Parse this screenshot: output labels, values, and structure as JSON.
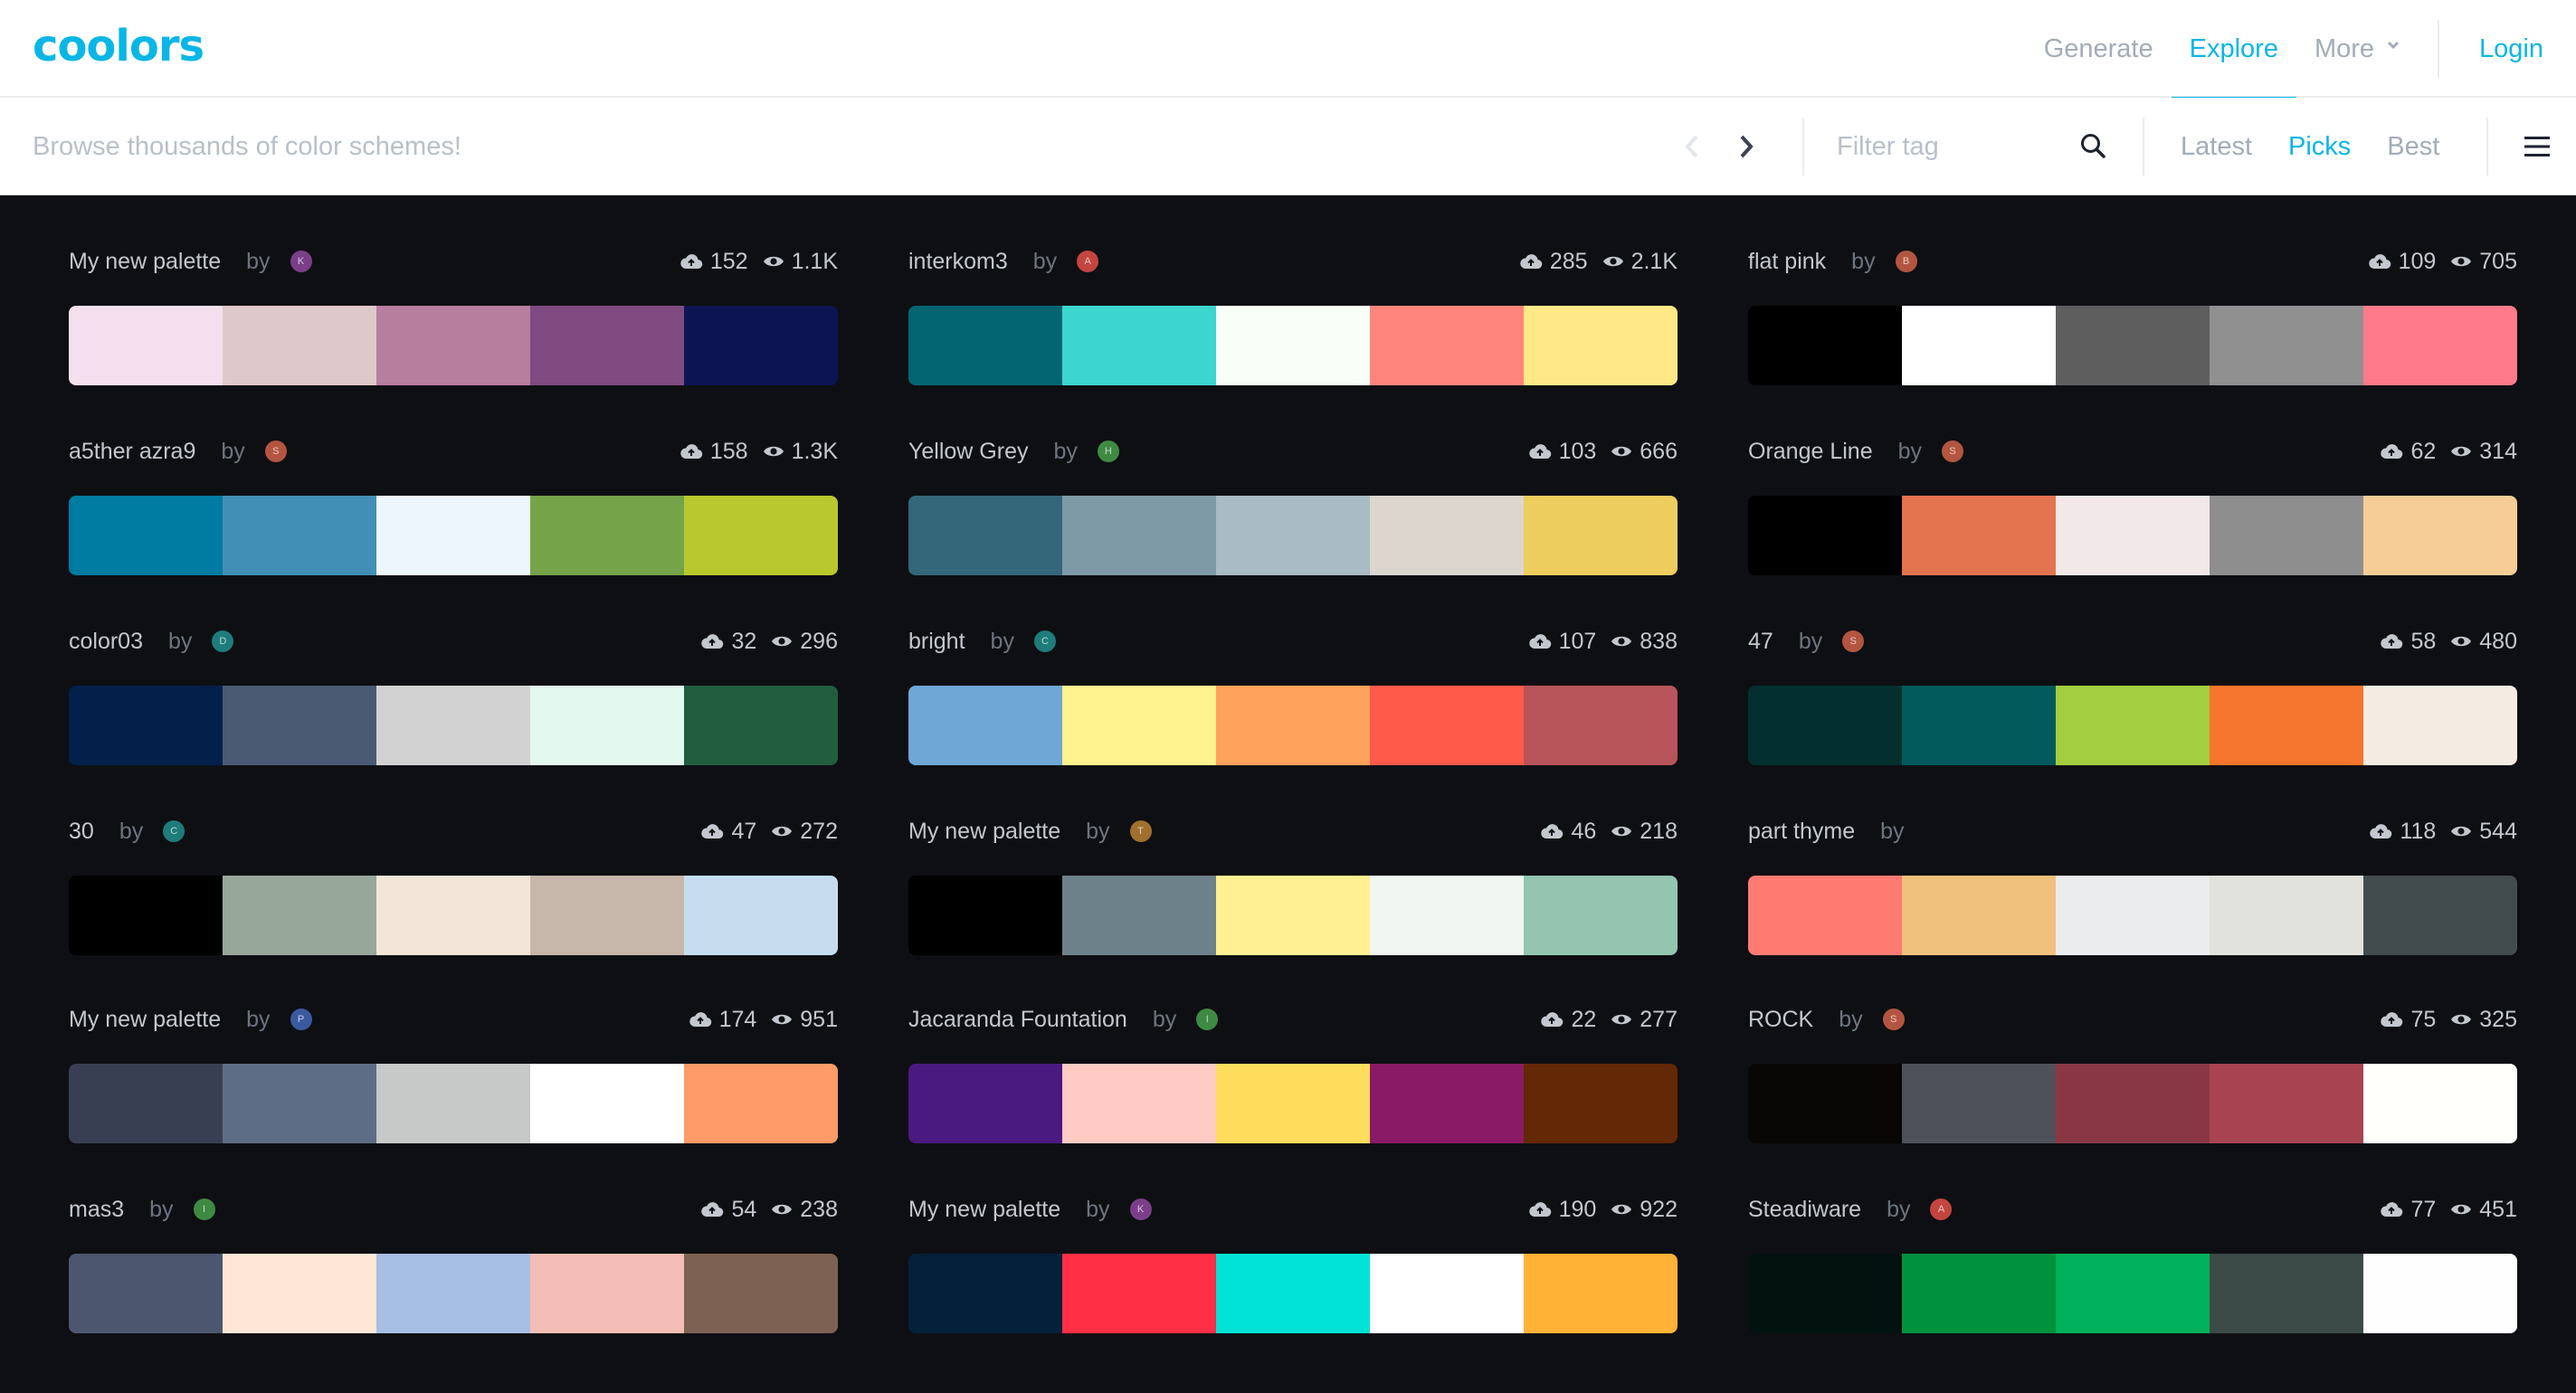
{
  "brand": {
    "logo": "coolors",
    "accent": "#0ab6e6"
  },
  "nav": {
    "generate": "Generate",
    "explore": "Explore",
    "more": "More",
    "login": "Login"
  },
  "subbar": {
    "browse_text": "Browse thousands of color schemes!",
    "filter_placeholder": "Filter tag",
    "tabs": [
      "Latest",
      "Picks",
      "Best"
    ],
    "active_tab": "Picks"
  },
  "icons": {
    "logo": "coolors-logo",
    "more_chevron": "chevron-down-icon",
    "prev": "chevron-left-icon",
    "next": "chevron-right-icon",
    "search": "search-icon",
    "menu": "hamburger-menu-icon",
    "likes": "cloud-upload-icon",
    "views": "eye-icon"
  },
  "palettes": [
    {
      "name": "My new palette",
      "by": "by",
      "avatar": "K",
      "avatar_color": "#7b3f8a",
      "likes": "152",
      "views": "1.1K",
      "colors": [
        "#f5dfef",
        "#dfc8ca",
        "#b77e9e",
        "#7e4a80",
        "#0c1551"
      ]
    },
    {
      "name": "interkom3",
      "by": "by",
      "avatar": "A",
      "avatar_color": "#c2463f",
      "likes": "285",
      "views": "2.1K",
      "colors": [
        "#036572",
        "#3dd5cf",
        "#f8fff6",
        "#ff847c",
        "#ffe986"
      ]
    },
    {
      "name": "flat pink",
      "by": "by",
      "avatar": "B",
      "avatar_color": "#b35540",
      "likes": "109",
      "views": "705",
      "colors": [
        "#000000",
        "#ffffff",
        "#5e5e5e",
        "#909090",
        "#ff7a8a"
      ]
    },
    {
      "name": "a5ther azra9",
      "by": "by",
      "avatar": "S",
      "avatar_color": "#b35540",
      "likes": "158",
      "views": "1.3K",
      "colors": [
        "#007ba1",
        "#418fb6",
        "#edf5fd",
        "#74a34a",
        "#b9c82e"
      ]
    },
    {
      "name": "Yellow Grey",
      "by": "by",
      "avatar": "H",
      "avatar_color": "#3f8a43",
      "likes": "103",
      "views": "666",
      "colors": [
        "#34677a",
        "#7e9aa7",
        "#a9bbc4",
        "#dcd6cf",
        "#eccd5e"
      ]
    },
    {
      "name": "Orange Line",
      "by": "by",
      "avatar": "S",
      "avatar_color": "#b35540",
      "likes": "62",
      "views": "314",
      "colors": [
        "#000000",
        "#e4744f",
        "#f2e8ea",
        "#8e8e8e",
        "#f6cd97"
      ]
    },
    {
      "name": "color03",
      "by": "by",
      "avatar": "D",
      "avatar_color": "#1e7c7a",
      "likes": "32",
      "views": "296",
      "colors": [
        "#022049",
        "#4a5a72",
        "#d2d2d2",
        "#e3f8ef",
        "#215e40"
      ]
    },
    {
      "name": "bright",
      "by": "by",
      "avatar": "C",
      "avatar_color": "#1e7c7a",
      "likes": "107",
      "views": "838",
      "colors": [
        "#6fa8d6",
        "#fff38f",
        "#ffa25b",
        "#ff5a4a",
        "#b7545a"
      ]
    },
    {
      "name": "47",
      "by": "by",
      "avatar": "S",
      "avatar_color": "#b35540",
      "likes": "58",
      "views": "480",
      "colors": [
        "#03302e",
        "#025a5d",
        "#a3ce3f",
        "#f5762c",
        "#f4ebe3"
      ]
    },
    {
      "name": "30",
      "by": "by",
      "avatar": "C",
      "avatar_color": "#1e7c7a",
      "likes": "47",
      "views": "272",
      "colors": [
        "#000000",
        "#97a79a",
        "#f2e6d8",
        "#c6b7aa",
        "#c6ddf0"
      ]
    },
    {
      "name": "My new palette",
      "by": "by",
      "avatar": "T",
      "avatar_color": "#a0702e",
      "likes": "46",
      "views": "218",
      "colors": [
        "#000000",
        "#6d818b",
        "#fff193",
        "#f0f6f1",
        "#93c5b0"
      ]
    },
    {
      "name": "part thyme",
      "by": "by",
      "avatar": "",
      "avatar_color": "transparent",
      "likes": "118",
      "views": "544",
      "colors": [
        "#ff7b72",
        "#f0c17d",
        "#ebecee",
        "#e2e2dc",
        "#424c4d"
      ]
    },
    {
      "name": "My new palette",
      "by": "by",
      "avatar": "P",
      "avatar_color": "#3a5aa0",
      "likes": "174",
      "views": "951",
      "colors": [
        "#393f53",
        "#5e6d86",
        "#c7c9c8",
        "#ffffff",
        "#ff9b66"
      ]
    },
    {
      "name": "Jacaranda Fountation",
      "by": "by",
      "avatar": "I",
      "avatar_color": "#3f8a43",
      "likes": "22",
      "views": "277",
      "colors": [
        "#4a1a80",
        "#ffcbc3",
        "#ffdd5c",
        "#8a1a65",
        "#632805"
      ]
    },
    {
      "name": "ROCK",
      "by": "by",
      "avatar": "S",
      "avatar_color": "#b35540",
      "likes": "75",
      "views": "325",
      "colors": [
        "#080706",
        "#4e515a",
        "#893843",
        "#a84452",
        "#fffffb"
      ]
    },
    {
      "name": "mas3",
      "by": "by",
      "avatar": "I",
      "avatar_color": "#3f8a43",
      "likes": "54",
      "views": "238",
      "colors": [
        "#4c566e",
        "#ffe6d7",
        "#a7bfe3",
        "#f2bdb4",
        "#7d6253"
      ]
    },
    {
      "name": "My new palette",
      "by": "by",
      "avatar": "K",
      "avatar_color": "#7b3f8a",
      "likes": "190",
      "views": "922",
      "colors": [
        "#04203a",
        "#ff2f46",
        "#00e3d6",
        "#fefffe",
        "#ffb236"
      ]
    },
    {
      "name": "Steadiware",
      "by": "by",
      "avatar": "A",
      "avatar_color": "#c2463f",
      "likes": "77",
      "views": "451",
      "colors": [
        "#02120f",
        "#00913f",
        "#00b05a",
        "#3b4a47",
        "#fefefe"
      ]
    }
  ]
}
